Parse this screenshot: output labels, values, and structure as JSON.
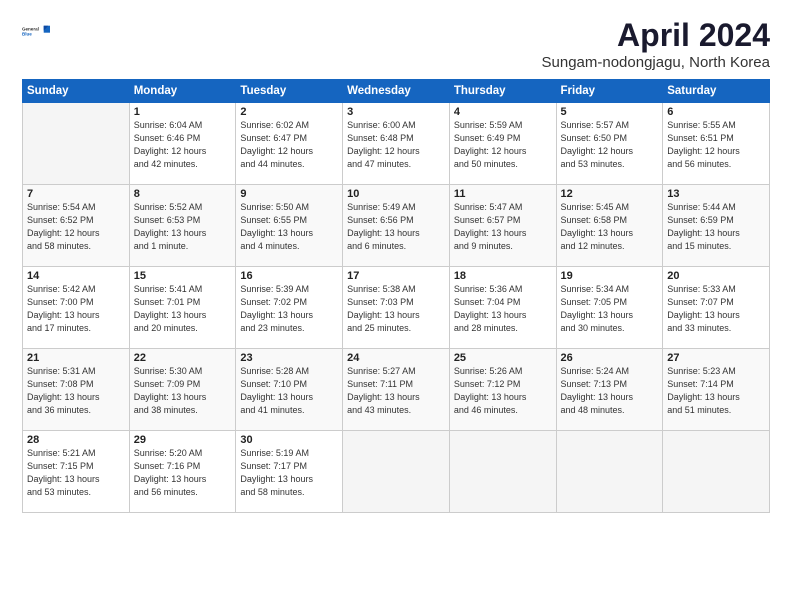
{
  "logo": {
    "general": "General",
    "blue": "Blue"
  },
  "header": {
    "title": "April 2024",
    "subtitle": "Sungam-nodongjagu, North Korea"
  },
  "weekdays": [
    "Sunday",
    "Monday",
    "Tuesday",
    "Wednesday",
    "Thursday",
    "Friday",
    "Saturday"
  ],
  "weeks": [
    [
      {
        "day": "",
        "info": ""
      },
      {
        "day": "1",
        "info": "Sunrise: 6:04 AM\nSunset: 6:46 PM\nDaylight: 12 hours\nand 42 minutes."
      },
      {
        "day": "2",
        "info": "Sunrise: 6:02 AM\nSunset: 6:47 PM\nDaylight: 12 hours\nand 44 minutes."
      },
      {
        "day": "3",
        "info": "Sunrise: 6:00 AM\nSunset: 6:48 PM\nDaylight: 12 hours\nand 47 minutes."
      },
      {
        "day": "4",
        "info": "Sunrise: 5:59 AM\nSunset: 6:49 PM\nDaylight: 12 hours\nand 50 minutes."
      },
      {
        "day": "5",
        "info": "Sunrise: 5:57 AM\nSunset: 6:50 PM\nDaylight: 12 hours\nand 53 minutes."
      },
      {
        "day": "6",
        "info": "Sunrise: 5:55 AM\nSunset: 6:51 PM\nDaylight: 12 hours\nand 56 minutes."
      }
    ],
    [
      {
        "day": "7",
        "info": "Sunrise: 5:54 AM\nSunset: 6:52 PM\nDaylight: 12 hours\nand 58 minutes."
      },
      {
        "day": "8",
        "info": "Sunrise: 5:52 AM\nSunset: 6:53 PM\nDaylight: 13 hours\nand 1 minute."
      },
      {
        "day": "9",
        "info": "Sunrise: 5:50 AM\nSunset: 6:55 PM\nDaylight: 13 hours\nand 4 minutes."
      },
      {
        "day": "10",
        "info": "Sunrise: 5:49 AM\nSunset: 6:56 PM\nDaylight: 13 hours\nand 6 minutes."
      },
      {
        "day": "11",
        "info": "Sunrise: 5:47 AM\nSunset: 6:57 PM\nDaylight: 13 hours\nand 9 minutes."
      },
      {
        "day": "12",
        "info": "Sunrise: 5:45 AM\nSunset: 6:58 PM\nDaylight: 13 hours\nand 12 minutes."
      },
      {
        "day": "13",
        "info": "Sunrise: 5:44 AM\nSunset: 6:59 PM\nDaylight: 13 hours\nand 15 minutes."
      }
    ],
    [
      {
        "day": "14",
        "info": "Sunrise: 5:42 AM\nSunset: 7:00 PM\nDaylight: 13 hours\nand 17 minutes."
      },
      {
        "day": "15",
        "info": "Sunrise: 5:41 AM\nSunset: 7:01 PM\nDaylight: 13 hours\nand 20 minutes."
      },
      {
        "day": "16",
        "info": "Sunrise: 5:39 AM\nSunset: 7:02 PM\nDaylight: 13 hours\nand 23 minutes."
      },
      {
        "day": "17",
        "info": "Sunrise: 5:38 AM\nSunset: 7:03 PM\nDaylight: 13 hours\nand 25 minutes."
      },
      {
        "day": "18",
        "info": "Sunrise: 5:36 AM\nSunset: 7:04 PM\nDaylight: 13 hours\nand 28 minutes."
      },
      {
        "day": "19",
        "info": "Sunrise: 5:34 AM\nSunset: 7:05 PM\nDaylight: 13 hours\nand 30 minutes."
      },
      {
        "day": "20",
        "info": "Sunrise: 5:33 AM\nSunset: 7:07 PM\nDaylight: 13 hours\nand 33 minutes."
      }
    ],
    [
      {
        "day": "21",
        "info": "Sunrise: 5:31 AM\nSunset: 7:08 PM\nDaylight: 13 hours\nand 36 minutes."
      },
      {
        "day": "22",
        "info": "Sunrise: 5:30 AM\nSunset: 7:09 PM\nDaylight: 13 hours\nand 38 minutes."
      },
      {
        "day": "23",
        "info": "Sunrise: 5:28 AM\nSunset: 7:10 PM\nDaylight: 13 hours\nand 41 minutes."
      },
      {
        "day": "24",
        "info": "Sunrise: 5:27 AM\nSunset: 7:11 PM\nDaylight: 13 hours\nand 43 minutes."
      },
      {
        "day": "25",
        "info": "Sunrise: 5:26 AM\nSunset: 7:12 PM\nDaylight: 13 hours\nand 46 minutes."
      },
      {
        "day": "26",
        "info": "Sunrise: 5:24 AM\nSunset: 7:13 PM\nDaylight: 13 hours\nand 48 minutes."
      },
      {
        "day": "27",
        "info": "Sunrise: 5:23 AM\nSunset: 7:14 PM\nDaylight: 13 hours\nand 51 minutes."
      }
    ],
    [
      {
        "day": "28",
        "info": "Sunrise: 5:21 AM\nSunset: 7:15 PM\nDaylight: 13 hours\nand 53 minutes."
      },
      {
        "day": "29",
        "info": "Sunrise: 5:20 AM\nSunset: 7:16 PM\nDaylight: 13 hours\nand 56 minutes."
      },
      {
        "day": "30",
        "info": "Sunrise: 5:19 AM\nSunset: 7:17 PM\nDaylight: 13 hours\nand 58 minutes."
      },
      {
        "day": "",
        "info": ""
      },
      {
        "day": "",
        "info": ""
      },
      {
        "day": "",
        "info": ""
      },
      {
        "day": "",
        "info": ""
      }
    ]
  ]
}
